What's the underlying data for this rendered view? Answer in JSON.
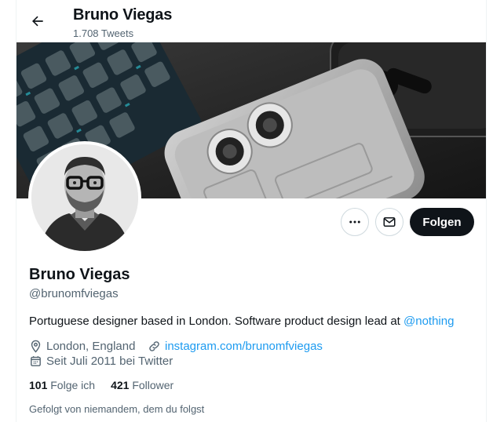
{
  "header": {
    "title": "Bruno Viegas",
    "tweet_count": "1.708 Tweets"
  },
  "profile": {
    "name": "Bruno Viegas",
    "handle": "@brunomfviegas",
    "bio_text": "Portuguese designer based in London. Software product design lead at ",
    "bio_mention": "@nothing",
    "location": "London, England",
    "website": "instagram.com/brunomfviegas",
    "joined": "Seit Juli 2011 bei Twitter",
    "following_count": "101",
    "following_label": "Folge ich",
    "followers_count": "421",
    "followers_label": "Follower",
    "followed_by": "Gefolgt von niemandem, dem du folgst"
  },
  "actions": {
    "follow_label": "Folgen",
    "more_icon": "more-dots-icon",
    "message_icon": "envelope-icon",
    "back_icon": "arrow-left-icon"
  },
  "colors": {
    "accent": "#1d9bf0",
    "text": "#0f1419",
    "secondary": "#536471",
    "border": "#cfd9de"
  }
}
